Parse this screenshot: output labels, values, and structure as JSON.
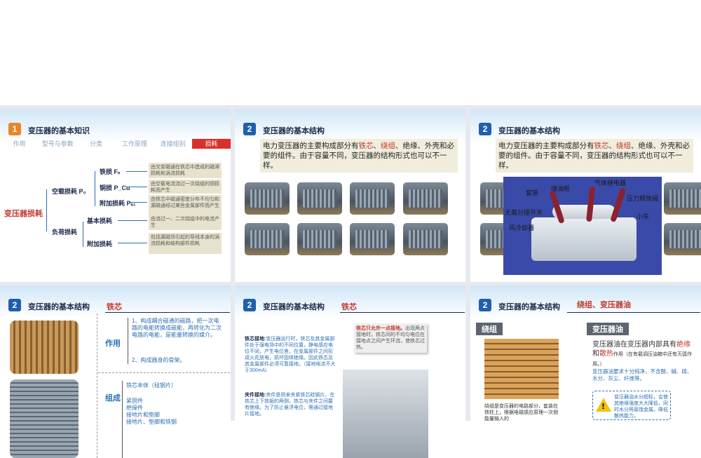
{
  "slide1": {
    "num": "1",
    "title": "变压器的基本知识",
    "tabs": [
      "作用",
      "型号与参数",
      "分类",
      "工作原理",
      "连接组别",
      "损耗"
    ],
    "root": "变压器损耗",
    "noload": "空载损耗 P₀",
    "load": "负荷损耗",
    "iron": "铁损 Fₑ",
    "copper": "铜损 P_Cu",
    "extra1": "附加损耗 Pₐ₁",
    "basic": "基本损耗",
    "extra2": "附加损耗",
    "desc": [
      "由交变磁通在铁芯中造成的磁滞损耗和涡流损耗",
      "由空载电流流过一次绕组的铜损耗而产生",
      "由铁芯中磁通密度分布不均匀和漏磁通经过某些金属部件而产生",
      "由流过一、二次绕组中的电流产生",
      "包括漏磁场引起的导线本身的涡流损耗和结构部件损耗"
    ]
  },
  "slide2": {
    "num": "2",
    "title": "变压器的基本结构",
    "text_a": "电力变压器的主要构成部分有",
    "text_red1": "铁芯",
    "text_sep1": "、",
    "text_red2": "绕组",
    "text_b": "、绝缘、外壳和必要的组件。由于容量不同，变压器的结构形式也可以不一样。"
  },
  "slide3": {
    "num": "2",
    "title": "变压器的基本结构",
    "text_a": "电力变压器的主要构成部分有",
    "text_red1": "铁芯",
    "text_sep1": "、",
    "text_red2": "绕组",
    "text_b": "、绝缘、外壳和必要的组件。由于容量不同，变压器的结构形式也可以不一样。",
    "labels": {
      "conservator": "储油柜",
      "bushing": "套管",
      "relay": "气体继电器",
      "valve": "压力释放阀",
      "switch": "无载分接开关",
      "cooler": "风冷却器",
      "cart": "小车"
    }
  },
  "slide4": {
    "num": "2",
    "title": "变压器的基本结构",
    "tag": "铁芯",
    "func_label": "作用",
    "func1": "1、构成耦合磁通的磁路，把一次电路的电能转换成磁能，再转化为二次电路的电能，是能量转换的媒介。",
    "func2": "2、构成器身的骨架。",
    "comp_label": "组成",
    "components": [
      "铁芯本体（硅钢片）",
      "紧固件",
      "绝缘件",
      "接地片和垫脚",
      "接地片、垫脚和铁钢"
    ]
  },
  "slide5": {
    "num": "2",
    "title": "变压器的基本结构",
    "tag": "铁芯",
    "ground_label": "铁芯接地:",
    "ground_text": "变压器运行时，铁芯及其金属部件处于强电场中的不同位置，静电感应电位不同，产生电位差，在金属部件之间形成火花放电，损坏固体绝缘。因此铁芯及其金属部件必须可靠接地。（接地电流不大于300mA）",
    "clamp_label": "夹件接地:",
    "clamp_text": "夹件是用来夹紧铁芯硅钢片，在铁芯上下铁轭的两侧，铁芯与夹件之间要有绝缘。为了防止悬浮电位，需通过接地片接地。",
    "note_title": "铁芯只允许一点接地。",
    "note_text": "出现两点接地时，铁芯间的不均匀电位在接地点之间产生环流，使铁芯过热。"
  },
  "slide6": {
    "num": "2",
    "title": "变压器的基本结构",
    "tag": "绕组、变压器油",
    "winding_tag": "绕组",
    "oil_tag": "变压器油",
    "winding_desc": "绕组是变压器的电路部分，套装在铁柱上，根据电磁感应原理一次侧能量输入的",
    "oil_text_a": "变压器油在变压器内部具有",
    "oil_red1": "绝缘",
    "oil_text_b": "和",
    "oil_red2": "散热",
    "oil_text_c": "作用（在有载调压油箱中还有灭弧作用。）",
    "oil_req": "变压器油要求十分纯净，不含酸、碱、硫、水分、灰尘、纤维等。",
    "warn": "变压器油水分超标，会使其绝缘强度大大降低，同时水分将腐蚀金属，降低散热能力。"
  }
}
